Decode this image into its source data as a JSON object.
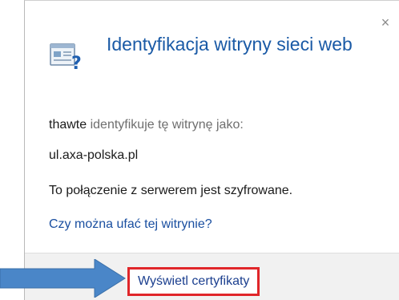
{
  "dialog": {
    "title": "Identyfikacja witryny sieci web",
    "close_label": "×",
    "issuer": "thawte",
    "identifies_text": "identyfikuje tę witrynę jako:",
    "domain": "ul.axa-polska.pl",
    "encryption_text": "To połączenie z serwerem jest szyfrowane.",
    "trust_link": "Czy można ufać tej witrynie?",
    "view_certificates_button": "Wyświetl certyfikaty"
  },
  "colors": {
    "title_blue": "#1a5aa6",
    "link_blue": "#1a4fa0",
    "highlight_red": "#e0262a",
    "arrow_blue": "#4a86c8",
    "footer_bg": "#f1f1f1"
  },
  "icons": {
    "site": "site-identity-question-icon",
    "close": "close-icon",
    "arrow": "right-arrow-icon"
  }
}
